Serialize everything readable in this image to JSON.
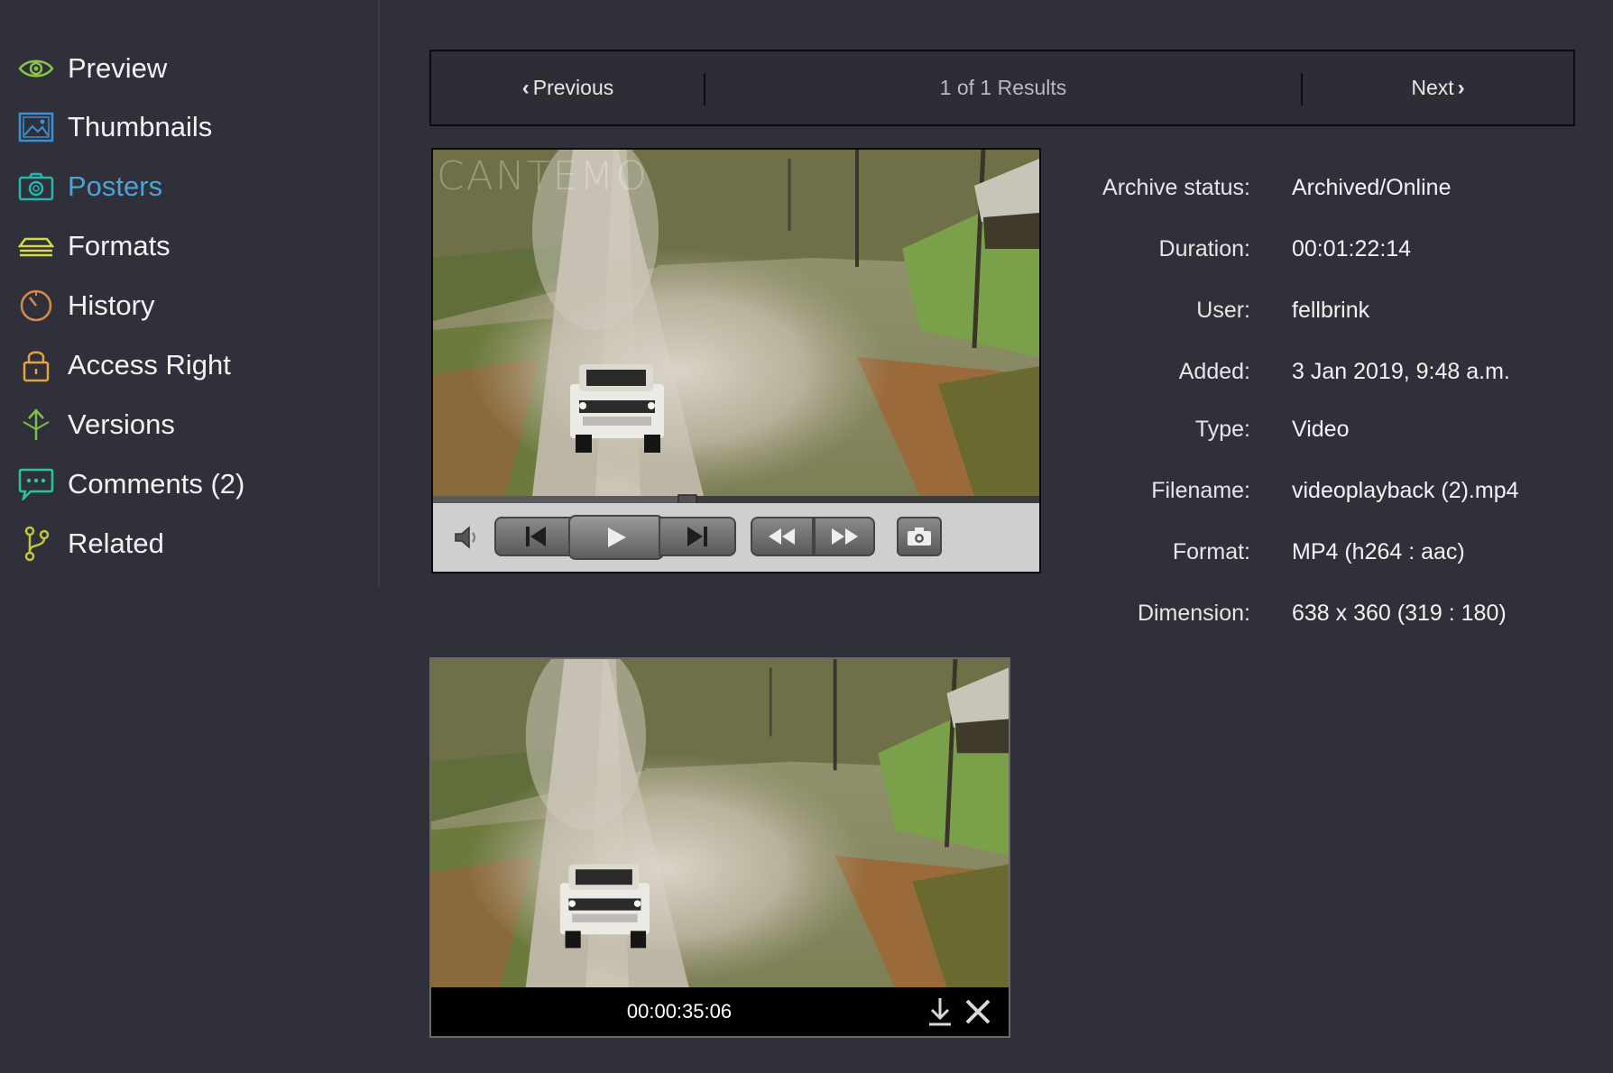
{
  "sidebar": {
    "items": [
      {
        "label": "Preview",
        "icon": "eye-icon",
        "color": "#8bc34a"
      },
      {
        "label": "Thumbnails",
        "icon": "image-icon",
        "color": "#3d8fd1"
      },
      {
        "label": "Posters",
        "icon": "camera-icon",
        "color": "#26b6b0",
        "active": true
      },
      {
        "label": "Formats",
        "icon": "layers-icon",
        "color": "#d8d84a"
      },
      {
        "label": "History",
        "icon": "clock-icon",
        "color": "#d98a4a"
      },
      {
        "label": "Access Right",
        "icon": "lock-icon",
        "color": "#e6a23c"
      },
      {
        "label": "Versions",
        "icon": "branch-arrow-icon",
        "color": "#7cc04a"
      },
      {
        "label": "Comments (2)",
        "icon": "chat-bubble-icon",
        "color": "#26c6a0"
      },
      {
        "label": "Related",
        "icon": "git-branch-icon",
        "color": "#c6c63a"
      }
    ]
  },
  "pager": {
    "previous": "Previous",
    "count": "1 of 1 Results",
    "next": "Next"
  },
  "player": {
    "watermark": "CANTEMO",
    "progress_fraction": 0.42,
    "controls": [
      "volume-icon",
      "skip-back-icon",
      "play-icon",
      "skip-forward-icon",
      "rewind-icon",
      "fast-forward-icon",
      "snapshot-camera-icon"
    ]
  },
  "metadata": [
    {
      "key": "Archive status:",
      "value": "Archived/Online"
    },
    {
      "key": "Duration:",
      "value": "00:01:22:14"
    },
    {
      "key": "User:",
      "value": "fellbrink"
    },
    {
      "key": "Added:",
      "value": "3 Jan 2019, 9:48 a.m."
    },
    {
      "key": "Type:",
      "value": "Video"
    },
    {
      "key": "Filename:",
      "value": "videoplayback (2).mp4"
    },
    {
      "key": "Format:",
      "value": "MP4 (h264 : aac)"
    },
    {
      "key": "Dimension:",
      "value": "638 x 360 (319 : 180)"
    }
  ],
  "poster": {
    "timecode": "00:00:35:06",
    "actions": [
      "download-icon",
      "close-icon"
    ]
  }
}
